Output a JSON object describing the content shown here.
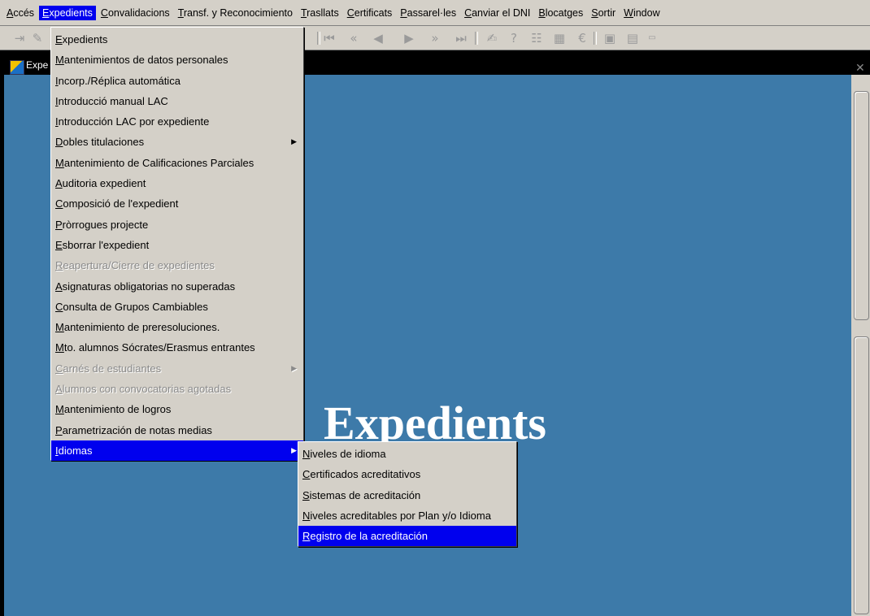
{
  "menubar": {
    "items": [
      {
        "label": "Accés",
        "ul": "A"
      },
      {
        "label": "Expedients",
        "ul": "E",
        "active": true
      },
      {
        "label": "Convalidacions",
        "ul": "C"
      },
      {
        "label": "Transf. y Reconocimiento",
        "ul": "T"
      },
      {
        "label": "Trasllats",
        "ul": "T"
      },
      {
        "label": "Certificats",
        "ul": "C"
      },
      {
        "label": "Passarel·les",
        "ul": "P"
      },
      {
        "label": "Canviar el DNI",
        "ul": "C"
      },
      {
        "label": "Blocatges",
        "ul": "B"
      },
      {
        "label": "Sortir",
        "ul": "S"
      },
      {
        "label": "Window",
        "ul": "W"
      }
    ]
  },
  "window": {
    "title": "Expe",
    "heading": "Expedients"
  },
  "expedients_menu": {
    "items": [
      {
        "label": "Expedients",
        "ul": "E"
      },
      {
        "label": "Mantenimientos de datos personales",
        "ul": "M"
      },
      {
        "label": "Incorp./Réplica automática",
        "ul": "I"
      },
      {
        "label": "Introducció manual LAC",
        "ul": "I"
      },
      {
        "label": "Introducción LAC por expediente",
        "ul": "I"
      },
      {
        "label": "Dobles titulaciones",
        "ul": "D",
        "submenu": true
      },
      {
        "label": "Mantenimiento de Calificaciones Parciales",
        "ul": "M"
      },
      {
        "label": "Auditoria expedient",
        "ul": "A"
      },
      {
        "label": "Composició de l'expedient",
        "ul": "C"
      },
      {
        "label": "Pròrrogues projecte",
        "ul": "P"
      },
      {
        "label": "Esborrar l'expedient",
        "ul": "E"
      },
      {
        "label": "Reapertura/Cierre de expedientes",
        "ul": "R",
        "disabled": true
      },
      {
        "label": "Asignaturas obligatorias no superadas",
        "ul": "A"
      },
      {
        "label": "Consulta de Grupos Cambiables",
        "ul": "C"
      },
      {
        "label": "Mantenimiento de preresoluciones.",
        "ul": "M"
      },
      {
        "label": "Mto. alumnos Sócrates/Erasmus entrantes",
        "ul": "M"
      },
      {
        "label": "Carnés de estudiantes",
        "ul": "C",
        "disabled": true,
        "submenu": true
      },
      {
        "label": "Alumnos con convocatorias agotadas",
        "ul": "A",
        "disabled": true
      },
      {
        "label": "Mantenimiento de logros",
        "ul": "M"
      },
      {
        "label": "Parametrización de notas medias",
        "ul": "P"
      },
      {
        "label": "Idiomas",
        "ul": "I",
        "submenu": true,
        "highlighted": true
      }
    ]
  },
  "idiomas_menu": {
    "items": [
      {
        "label": "Niveles de idioma",
        "ul": "N"
      },
      {
        "label": "Certificados acreditativos",
        "ul": "C"
      },
      {
        "label": "Sistemas de acreditación",
        "ul": "S"
      },
      {
        "label": "Niveles acreditables por Plan y/o Idioma",
        "ul": "N"
      },
      {
        "label": "Registro de la acreditación",
        "ul": "R",
        "highlighted": true
      }
    ]
  },
  "colors": {
    "menu_bg": "#d4d0c8",
    "highlight": "#0000ee",
    "canvas_bg": "#3d7aa9",
    "disabled_text": "#8a8a8a"
  },
  "toolbar_icons": [
    "exit-icon",
    "separator",
    "first-record-icon",
    "previous-block-icon",
    "previous-record-icon",
    "next-record-icon",
    "next-block-icon",
    "last-record-icon",
    "separator",
    "edit-icon",
    "help-icon",
    "query-icon",
    "calendar-icon",
    "euro-icon",
    "separator",
    "save-icon",
    "print-icon",
    "more-icon"
  ]
}
